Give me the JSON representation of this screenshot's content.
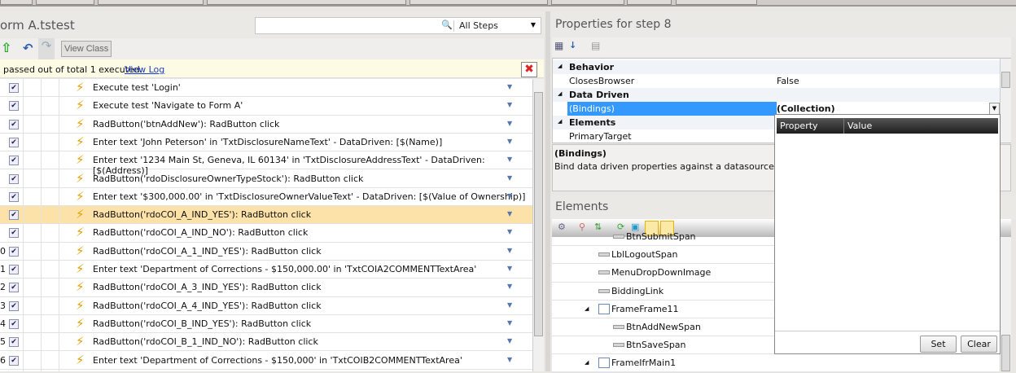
{
  "test_panel": {
    "title": "orm A.tstest",
    "search": {
      "value": "",
      "filter": "All Steps"
    },
    "toolbar": {
      "view_class": "View Class"
    },
    "info": {
      "text": "passed out of total 1 executed.",
      "link": "View Log"
    },
    "steps": [
      {
        "num": "",
        "text": "Execute test 'Login'",
        "checked": true
      },
      {
        "num": "",
        "text": "Execute test 'Navigate to Form A'",
        "checked": true
      },
      {
        "num": "",
        "text": "RadButton('btnAddNew'): RadButton click",
        "checked": true
      },
      {
        "num": "",
        "text": "Enter text 'John Peterson' in 'TxtDisclosureNameText' - DataDriven: [$(Name)]",
        "checked": true
      },
      {
        "num": "",
        "text": "Enter text '1234 Main St, Geneva, IL 60134' in 'TxtDisclosureAddressText' - DataDriven: [$(Address)]",
        "checked": true
      },
      {
        "num": "",
        "text": "RadButton('rdoDisclosureOwnerTypeStock'): RadButton click",
        "checked": true
      },
      {
        "num": "",
        "text": "Enter text '$300,000.00' in 'TxtDisclosureOwnerValueText' - DataDriven: [$(Value of Ownership)]",
        "checked": true
      },
      {
        "num": "",
        "text": "RadButton('rdoCOI_A_IND_YES'): RadButton click",
        "checked": true,
        "selected": true
      },
      {
        "num": "",
        "text": "RadButton('rdoCOI_A_IND_NO'): RadButton click",
        "checked": true
      },
      {
        "num": "0",
        "text": "RadButton('rdoCOI_A_1_IND_YES'): RadButton click",
        "checked": true
      },
      {
        "num": "1",
        "text": "Enter text 'Department of Corrections - $150,000.00' in 'TxtCOIA2COMMENTTextArea'",
        "checked": true
      },
      {
        "num": "2",
        "text": "RadButton('rdoCOI_A_3_IND_YES'): RadButton click",
        "checked": true
      },
      {
        "num": "3",
        "text": "RadButton('rdoCOI_A_4_IND_YES'): RadButton click",
        "checked": true
      },
      {
        "num": "4",
        "text": "RadButton('rdoCOI_B_IND_YES'): RadButton click",
        "checked": true
      },
      {
        "num": "5",
        "text": "RadButton('rdoCOI_B_1_IND_NO'): RadButton click",
        "checked": true
      },
      {
        "num": "6",
        "text": "Enter text 'Department of Corrections - $150,000' in 'TxtCOIB2COMMENTTextArea'",
        "checked": true
      }
    ]
  },
  "properties": {
    "title": "Properties for step 8",
    "rows": [
      {
        "type": "cat",
        "name": "Behavior",
        "value": ""
      },
      {
        "type": "prop",
        "name": "ClosesBrowser",
        "value": "False"
      },
      {
        "type": "cat",
        "name": "Data Driven",
        "value": ""
      },
      {
        "type": "prop",
        "name": "(Bindings)",
        "value": "(Collection)",
        "selected": true
      },
      {
        "type": "cat",
        "name": "Elements",
        "value": ""
      },
      {
        "type": "prop",
        "name": "PrimaryTarget",
        "value": ""
      }
    ],
    "desc_title": "(Bindings)",
    "desc_text": "Bind data driven properties against a datasource. Click th"
  },
  "bindings_popup": {
    "col_property": "Property",
    "col_value": "Value",
    "set": "Set",
    "clear": "Clear"
  },
  "elements": {
    "title": "Elements",
    "tree": [
      {
        "label": "BtnSubmitSpan",
        "indent": 2,
        "kind": "element"
      },
      {
        "label": "LblLogoutSpan",
        "indent": 1,
        "kind": "element"
      },
      {
        "label": "MenuDropDownImage",
        "indent": 1,
        "kind": "element"
      },
      {
        "label": "BiddingLink",
        "indent": 1,
        "kind": "element"
      },
      {
        "label": "FrameFrame11",
        "indent": 1,
        "kind": "frame"
      },
      {
        "label": "BtnAddNewSpan",
        "indent": 2,
        "kind": "element"
      },
      {
        "label": "BtnSaveSpan",
        "indent": 2,
        "kind": "element"
      },
      {
        "label": "FrameIfrMain1",
        "indent": 1,
        "kind": "frame"
      }
    ]
  },
  "colors": {
    "selected_row": "#fce1a8",
    "selected_prop": "#3399ff",
    "info_bar": "#fdfbe3",
    "link": "#1a3fcf"
  }
}
